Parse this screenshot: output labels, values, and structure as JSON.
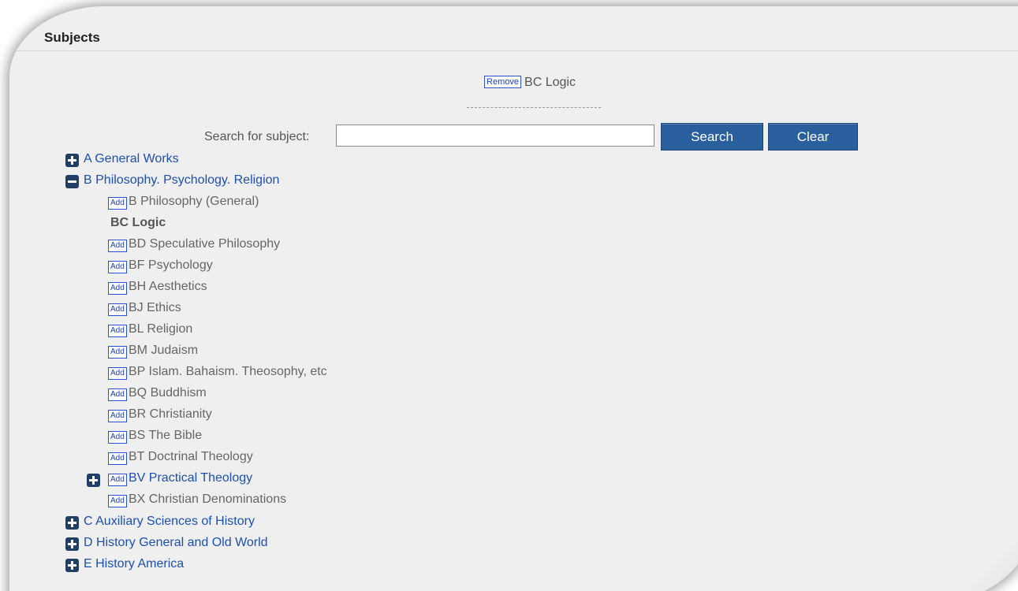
{
  "header": {
    "title": "Subjects"
  },
  "selected": {
    "remove_label": "Remove",
    "subject": "BC Logic"
  },
  "search": {
    "label": "Search for subject:",
    "value": "",
    "search_label": "Search",
    "clear_label": "Clear"
  },
  "tree": {
    "top": [
      {
        "label": "A General Works",
        "toggle": "plus"
      },
      {
        "label": "B Philosophy. Psychology. Religion",
        "toggle": "minus"
      },
      {
        "label": "C Auxiliary Sciences of History",
        "toggle": "plus"
      },
      {
        "label": "D History General and Old World",
        "toggle": "plus"
      },
      {
        "label": "E History America",
        "toggle": "plus"
      }
    ],
    "add_label": "Add",
    "children": [
      {
        "label": "B Philosophy (General)",
        "add": true
      },
      {
        "label": "BC Logic",
        "add": false,
        "selected": true
      },
      {
        "label": "BD Speculative Philosophy",
        "add": true
      },
      {
        "label": "BF Psychology",
        "add": true
      },
      {
        "label": "BH Aesthetics",
        "add": true
      },
      {
        "label": "BJ Ethics",
        "add": true
      },
      {
        "label": "BL Religion",
        "add": true
      },
      {
        "label": "BM Judaism",
        "add": true
      },
      {
        "label": "BP Islam. Bahaism. Theosophy, etc",
        "add": true
      },
      {
        "label": "BQ Buddhism",
        "add": true
      },
      {
        "label": "BR Christianity",
        "add": true
      },
      {
        "label": "BS The Bible",
        "add": true
      },
      {
        "label": "BT Doctrinal Theology",
        "add": true
      },
      {
        "label": "BV Practical Theology",
        "add": true,
        "expandable": true
      },
      {
        "label": "BX Christian Denominations",
        "add": true
      }
    ]
  },
  "colors": {
    "link": "#1c4fb4",
    "button": "#285f9c",
    "toggle": "#1f3f66"
  }
}
